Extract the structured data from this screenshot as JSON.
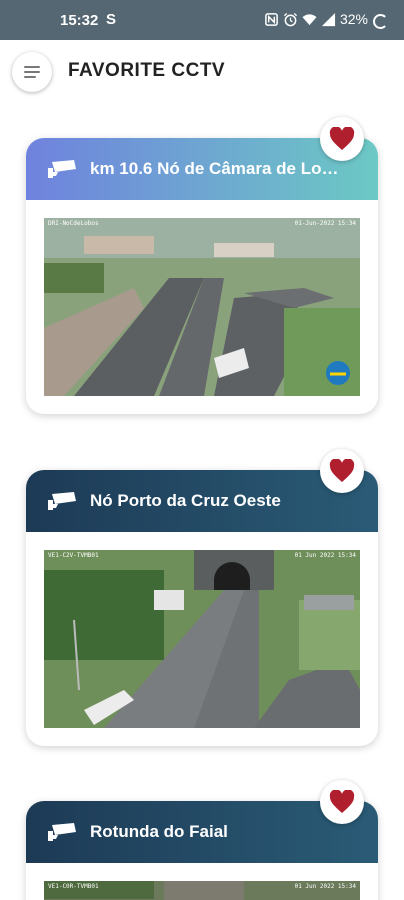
{
  "status_bar": {
    "time": "15:32",
    "s_icon": "S",
    "battery": "32%",
    "icons": [
      "nfc-icon",
      "alarm-icon",
      "wifi-icon",
      "signal-icon",
      "battery-icon"
    ]
  },
  "app_bar": {
    "title": "FAVORITE CCTV",
    "menu_icon": "menu-icon"
  },
  "cards": [
    {
      "title": "km 10.6 Nó de Câmara de Lob...",
      "header_gradient": [
        "#6f82de",
        "#6cc9c4"
      ],
      "favorite": true,
      "osd_left": "DRI-NoCdeLobos",
      "osd_right": "01-Jun-2022 15:34"
    },
    {
      "title": "Nó Porto da Cruz Oeste",
      "header_gradient": [
        "#1d3a55",
        "#2a5b76"
      ],
      "favorite": true,
      "osd_left": "VE1-C2V-TVMB01",
      "osd_right": "01 Jun 2022 15:34"
    },
    {
      "title": "Rotunda do Faial",
      "header_gradient": [
        "#1d3a55",
        "#2a5b76"
      ],
      "favorite": true,
      "osd_left": "VE1-C0R-TVMB01",
      "osd_right": "01 Jun 2022 15:34"
    }
  ],
  "colors": {
    "heart": "#b01f2e",
    "status_bar": "#546773"
  }
}
